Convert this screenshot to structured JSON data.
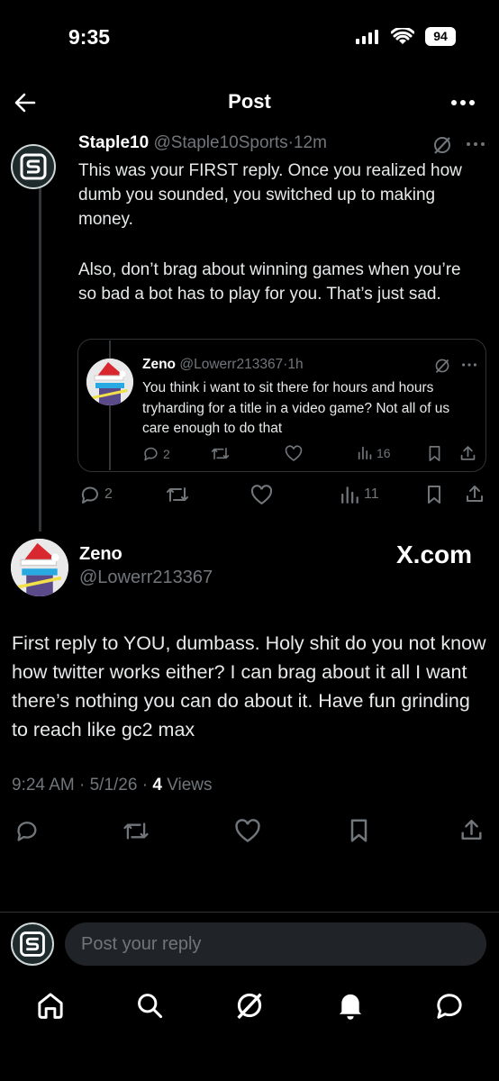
{
  "status_bar": {
    "time": "9:35",
    "battery": "94"
  },
  "header": {
    "title": "Post"
  },
  "parent_post": {
    "author": "Staple10",
    "handle": "@Staple10Sports",
    "separator": "·",
    "age": "12m",
    "text_p1": "This was your FIRST reply. Once you realized how dumb you sounded, you switched up to making money.",
    "text_p2": "Also, don’t brag about winning games when you’re so bad a bot has to play for you. That’s just sad.",
    "replies": "2",
    "views": "11"
  },
  "quoted_post": {
    "author": "Zeno",
    "handle": "@Lowerr213367",
    "separator": "·",
    "age": "1h",
    "text": "You think i want to sit there for hours and hours tryharding for a title in a video game? Not all of us care enough to do that",
    "replies": "2",
    "views": "16"
  },
  "main_post": {
    "author": "Zeno",
    "handle": "@Lowerr213367",
    "watermark": "X.com",
    "text": "First reply to YOU, dumbass. Holy shit do you not know how twitter works either? I can brag about it all I want there’s nothing you can do about it. Have fun grinding to reach like gc2 max",
    "time": "9:24 AM",
    "date": "5/1/26",
    "sep": "·",
    "views_count": "4",
    "views_label": "Views"
  },
  "reply_bar": {
    "placeholder": "Post your reply"
  },
  "colors": {
    "background": "#000000",
    "text": "#e7e9ea",
    "muted": "#71767b",
    "border": "#2f3336",
    "accent": "#1d9bf0"
  },
  "icons": [
    "back-arrow-icon",
    "more-icon",
    "grok-icon",
    "reply-icon",
    "repost-icon",
    "like-icon",
    "views-icon",
    "bookmark-icon",
    "share-icon",
    "home-icon",
    "search-icon",
    "notifications-icon",
    "messages-icon"
  ]
}
